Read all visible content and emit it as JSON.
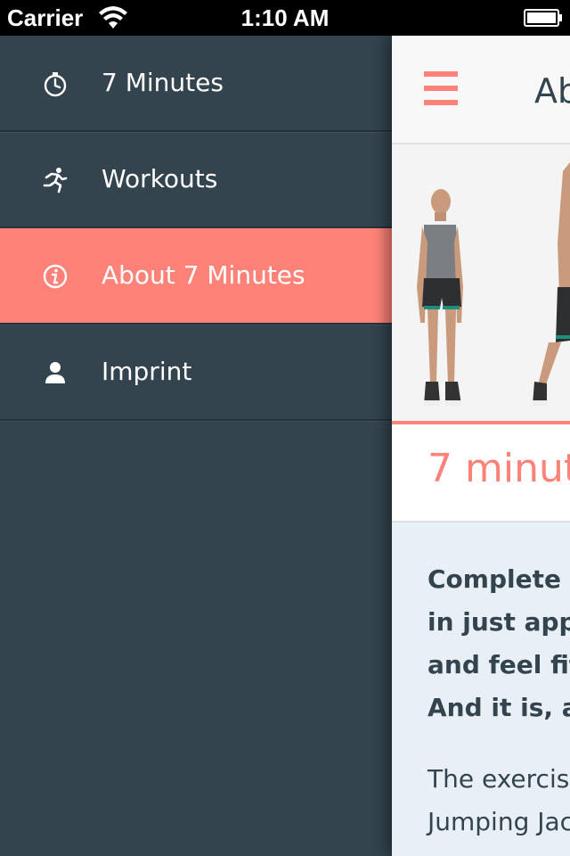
{
  "status_bar": {
    "carrier": "Carrier",
    "time": "1:10 AM"
  },
  "sidebar": {
    "items": [
      {
        "label": "7 Minutes",
        "icon": "stopwatch-icon",
        "active": false
      },
      {
        "label": "Workouts",
        "icon": "running-person-icon",
        "active": false
      },
      {
        "label": "About 7 Minutes",
        "icon": "info-icon",
        "active": true
      },
      {
        "label": "Imprint",
        "icon": "person-icon",
        "active": false
      }
    ]
  },
  "main": {
    "nav_title": "Ab",
    "section_title": "7 minut",
    "intro_lines": [
      "Complete tw",
      "in just appro",
      "and feel fit",
      "And it is, at"
    ],
    "body_lines": [
      "The exercis",
      "Jumping Jac"
    ]
  },
  "colors": {
    "accent": "#ff8278",
    "sidebar_bg": "#34444f",
    "content_bg": "#e9f0f5"
  }
}
